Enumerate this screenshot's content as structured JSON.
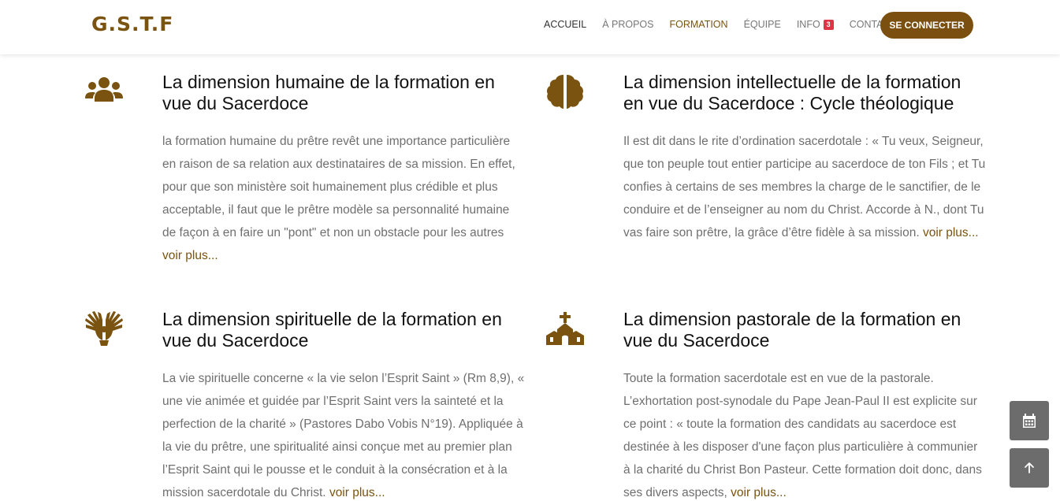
{
  "header": {
    "logo": "G.S.T.F",
    "nav": [
      {
        "label": "ACCUEIL"
      },
      {
        "label": "À PROPOS"
      },
      {
        "label": "FORMATION"
      },
      {
        "label": "ÉQUIPE"
      },
      {
        "label": "INFO",
        "badge": "3"
      },
      {
        "label": "CONTACT"
      }
    ],
    "login": "SE CONNECTER"
  },
  "items": [
    {
      "icon": "users-icon",
      "title": "La dimension humaine de la formation en vue du Sacerdoce",
      "text": "la formation humaine du prêtre revêt une importance particulière en raison de sa relation aux destinataires de sa mission. En effet, pour que son ministère soit humainement plus crédible et plus acceptable, il faut que le prêtre modèle sa personnalité humaine de façon à en faire un \"pont\" et non un obstacle pour les autres",
      "more": "voir plus..."
    },
    {
      "icon": "brain-icon",
      "title": "La dimension intellectuelle de la formation en vue du Sacerdoce : Cycle théologique",
      "text": "Il est dit dans le rite d’ordination sacerdotale : « Tu veux, Seigneur, que ton peuple tout entier participe au sacerdoce de ton Fils ; et Tu confies à certains de ses membres la charge de le sanctifier, de le conduire et de l’enseigner au nom du Christ. Accorde à N., dont Tu vas faire son prêtre, la grâce d’être fidèle à sa mission.",
      "more": "voir plus..."
    },
    {
      "icon": "holy-spirit-icon",
      "title": "La dimension spirituelle de la formation en vue du Sacerdoce",
      "text": "La vie spirituelle concerne « la vie selon l’Esprit Saint » (Rm 8,9), « une vie animée et guidée par l’Esprit Saint vers la sainteté et la perfection de la charité » (Pastores Dabo Vobis N°19). Appliquée à la vie du prêtre, une spiritualité ainsi conçue met au premier plan l’Esprit Saint qui le pousse et le conduit à la consécration et à la mission sacerdotale du Christ.",
      "more": "voir plus..."
    },
    {
      "icon": "church-icon",
      "title": "La dimension pastorale de la formation en vue du Sacerdoce",
      "text": "Toute la formation sacerdotale est en vue de la pastorale. L’exhortation post-synodale du Pape Jean-Paul II est explicite sur ce point : « toute la formation des candidats au sacerdoce est destinée à les disposer d'une façon plus particulière à communier à la charité du Christ Bon Pasteur. Cette formation doit donc, dans ses divers aspects,",
      "more": "voir plus..."
    }
  ],
  "floating": {
    "calendar_icon": "calendar-icon",
    "top_icon": "arrow-up-icon"
  },
  "colors": {
    "brand": "#7a5310",
    "badge": "#dc3545",
    "float_bg": "#6c6c6c"
  }
}
